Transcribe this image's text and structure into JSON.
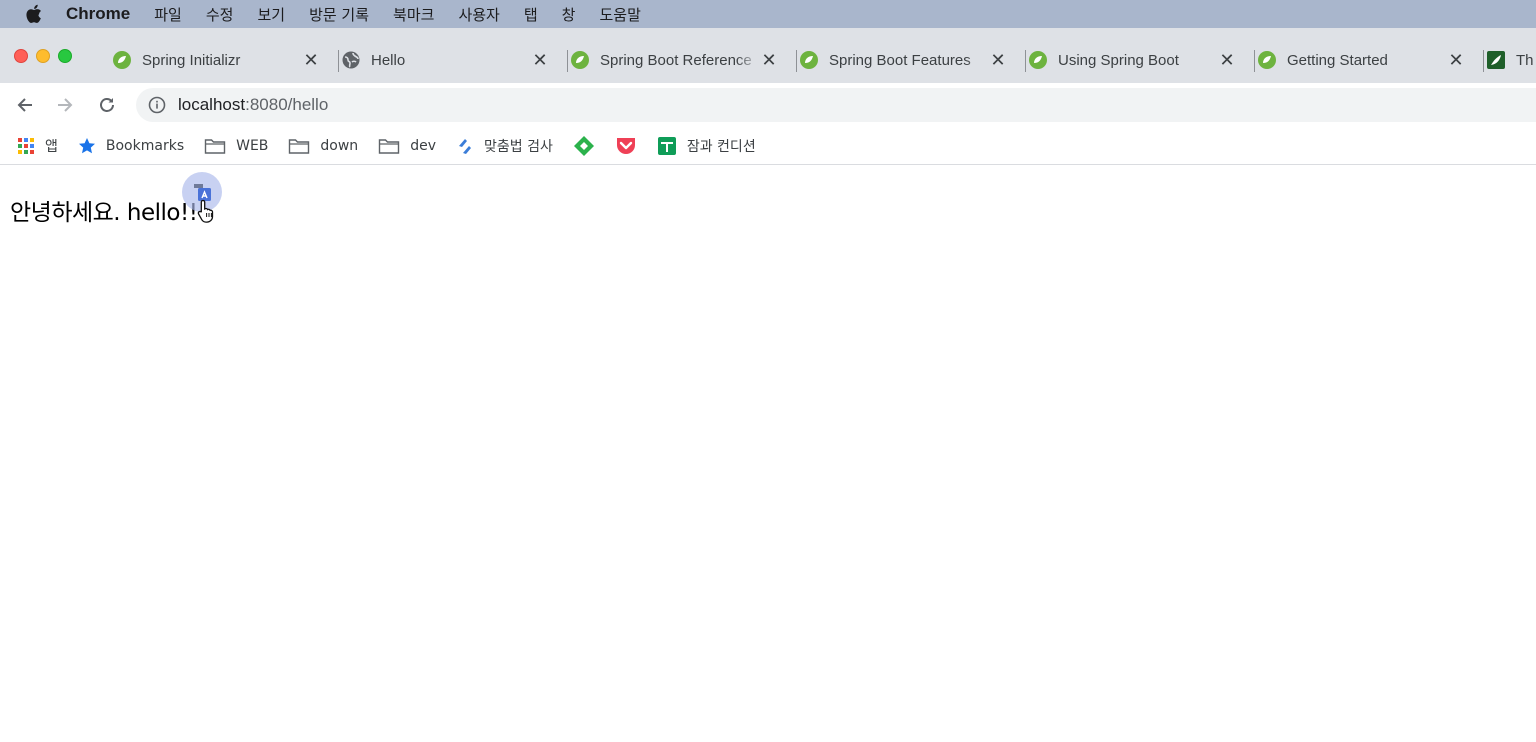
{
  "menubar": {
    "app_name": "Chrome",
    "items": [
      "파일",
      "수정",
      "보기",
      "방문 기록",
      "북마크",
      "사용자",
      "탭",
      "창",
      "도움말"
    ]
  },
  "tabs": [
    {
      "title": "Spring Initializr",
      "icon": "spring-leaf-icon"
    },
    {
      "title": "Hello",
      "icon": "globe-icon"
    },
    {
      "title": "Spring Boot Reference",
      "icon": "spring-leaf-icon"
    },
    {
      "title": "Spring Boot Features",
      "icon": "spring-leaf-icon"
    },
    {
      "title": "Using Spring Boot",
      "icon": "spring-leaf-icon"
    },
    {
      "title": "Getting Started",
      "icon": "spring-leaf-icon"
    },
    {
      "title": "Th",
      "icon": "thymeleaf-icon"
    }
  ],
  "toolbar": {
    "url_host": "localhost",
    "url_rest": ":8080/hello"
  },
  "bookmarks": [
    {
      "label": "앱",
      "icon": "apps-grid-icon"
    },
    {
      "label": "Bookmarks",
      "icon": "star-icon"
    },
    {
      "label": "WEB",
      "icon": "folder-icon"
    },
    {
      "label": "down",
      "icon": "folder-icon"
    },
    {
      "label": "dev",
      "icon": "folder-icon"
    },
    {
      "label": "맞춤법 검사",
      "icon": "spell-check-icon"
    },
    {
      "label": "",
      "icon": "feedly-icon"
    },
    {
      "label": "",
      "icon": "pocket-icon"
    },
    {
      "label": "잠과 컨디션",
      "icon": "sheets-icon"
    }
  ],
  "page": {
    "greeting": "안녕하세요. hello!!"
  },
  "colors": {
    "menubar_bg": "#a9b6cc",
    "tabstrip_bg": "#dee1e6",
    "omnibox_bg": "#f1f3f4",
    "spring_green": "#6db33f"
  }
}
